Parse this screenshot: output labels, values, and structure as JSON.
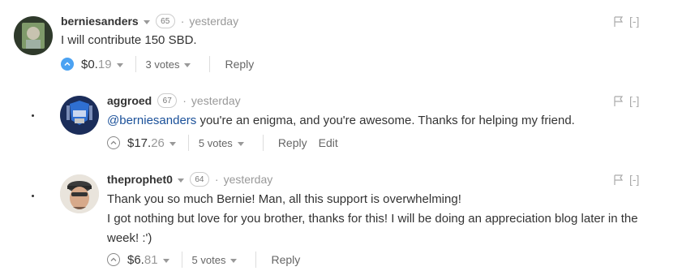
{
  "comments": [
    {
      "author": "berniesanders",
      "reputation": "65",
      "time": "yesterday",
      "body_lines": [
        "I will contribute 150 SBD."
      ],
      "payout_dollars": "$0.",
      "payout_cents": "19",
      "votes": "3 votes",
      "actions": [
        "Reply"
      ],
      "upvoted": true,
      "collapse": "[-]"
    },
    {
      "author": "aggroed",
      "reputation": "67",
      "time": "yesterday",
      "mention": "@berniesanders",
      "body_rest": " you're an enigma, and you're awesome. Thanks for helping my friend.",
      "payout_dollars": "$17.",
      "payout_cents": "26",
      "votes": "5 votes",
      "actions": [
        "Reply",
        "Edit"
      ],
      "upvoted": false,
      "collapse": "[-]"
    },
    {
      "author": "theprophet0",
      "reputation": "64",
      "time": "yesterday",
      "body_lines": [
        "Thank you so much Bernie! Man, all this support is overwhelming!",
        "I got nothing but love for you brother, thanks for this! I will be doing an appreciation blog later in the",
        "week! :')"
      ],
      "payout_dollars": "$6.",
      "payout_cents": "81",
      "votes": "5 votes",
      "actions": [
        "Reply"
      ],
      "upvoted": false,
      "collapse": "[-]"
    }
  ],
  "colors": {
    "accent": "#4ba2f2",
    "link": "#1a5099",
    "muted": "#999999"
  },
  "icons": [
    "upvote-icon",
    "flag-icon",
    "avatar"
  ]
}
